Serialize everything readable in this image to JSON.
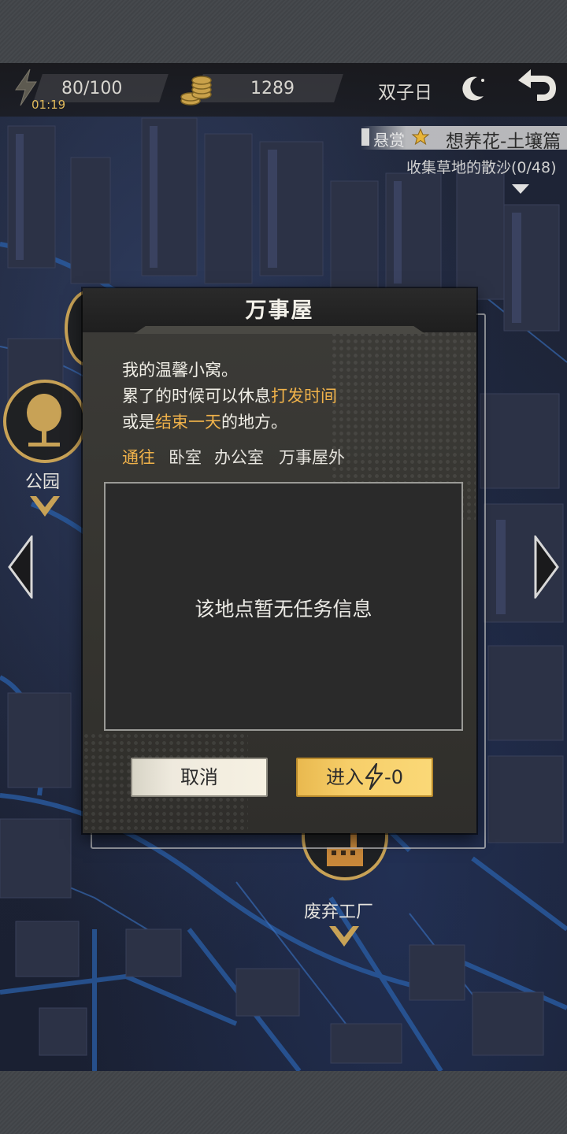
{
  "hud": {
    "energy": "80/100",
    "timer": "01:19",
    "coins": "1289",
    "day": "双子日"
  },
  "quest": {
    "label": "悬赏",
    "title": "想养花-土壤篇",
    "progress": "收集草地的散沙(0/48)"
  },
  "map": {
    "markers": {
      "park": "公园",
      "factory": "废弃工厂"
    }
  },
  "dialog": {
    "title": "万事屋",
    "line1": "我的温馨小窝。",
    "line2_prefix": "累了的时候可以休息",
    "line2_highlight": "打发时间",
    "line3_prefix": "或是",
    "line3_highlight": "结束一天",
    "line3_suffix": "的地方。",
    "goto_label": "通往",
    "goto_items": [
      "卧室",
      "办公室",
      "万事屋外"
    ],
    "empty_message": "该地点暂无任务信息",
    "cancel_label": "取消",
    "enter_label": "进入",
    "enter_cost": "-0"
  },
  "colors": {
    "accent": "#f0b24a",
    "marker_ring": "#c8a256",
    "enter_button": "#f7cf6a",
    "cancel_button": "#efeade"
  }
}
